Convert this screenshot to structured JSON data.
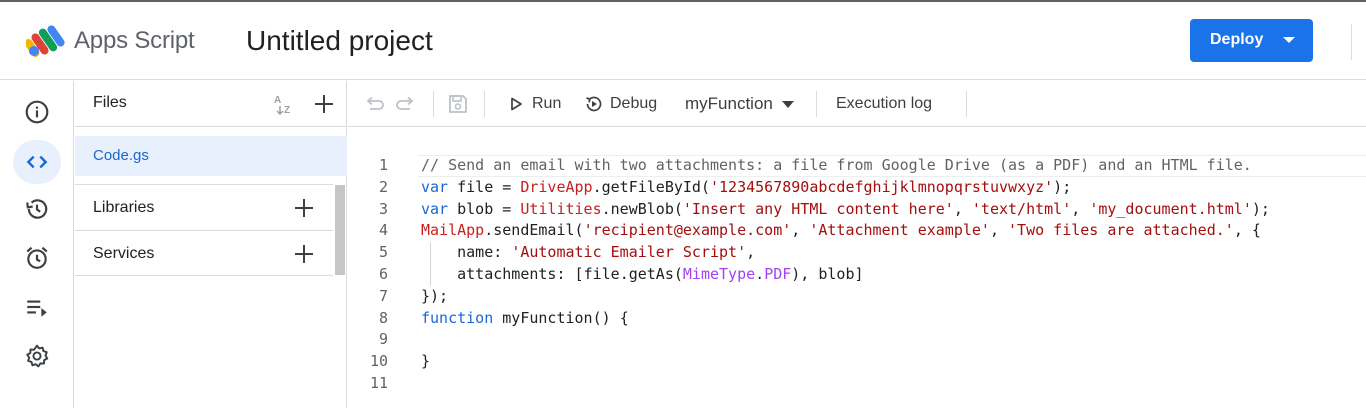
{
  "header": {
    "app_name": "Apps Script",
    "project_title": "Untitled project",
    "deploy_label": "Deploy"
  },
  "rail": {
    "items": [
      {
        "icon": "info-icon"
      },
      {
        "icon": "code-icon",
        "active": true
      },
      {
        "icon": "history-icon"
      },
      {
        "icon": "alarm-icon"
      },
      {
        "icon": "executions-icon"
      },
      {
        "icon": "gear-icon"
      }
    ]
  },
  "files_panel": {
    "title": "Files",
    "files": [
      "Code.gs"
    ],
    "sections": [
      "Libraries",
      "Services"
    ]
  },
  "toolbar": {
    "run_label": "Run",
    "debug_label": "Debug",
    "function_select": "myFunction",
    "execution_log_label": "Execution log"
  },
  "editor": {
    "line_numbers": [
      "1",
      "2",
      "3",
      "4",
      "5",
      "6",
      "7",
      "8",
      "9",
      "10",
      "11"
    ],
    "lines": [
      "// Send an email with two attachments: a file from Google Drive (as a PDF) and an HTML file.",
      "var file = DriveApp.getFileById('1234567890abcdefghijklmnopqrstuvwxyz');",
      "var blob = Utilities.newBlob('Insert any HTML content here', 'text/html', 'my_document.html');",
      "MailApp.sendEmail('recipient@example.com', 'Attachment example', 'Two files are attached.', {",
      "    name: 'Automatic Emailer Script',",
      "    attachments: [file.getAs(MimeType.PDF), blob]",
      "});",
      "function myFunction() {",
      "",
      "}",
      ""
    ]
  },
  "colors": {
    "accent": "#1a73e8",
    "keyword": "#1967d2",
    "object": "#c5221f",
    "string": "#a50e0e",
    "comment": "#5f6368",
    "selected_bg": "#e8f0fe"
  }
}
